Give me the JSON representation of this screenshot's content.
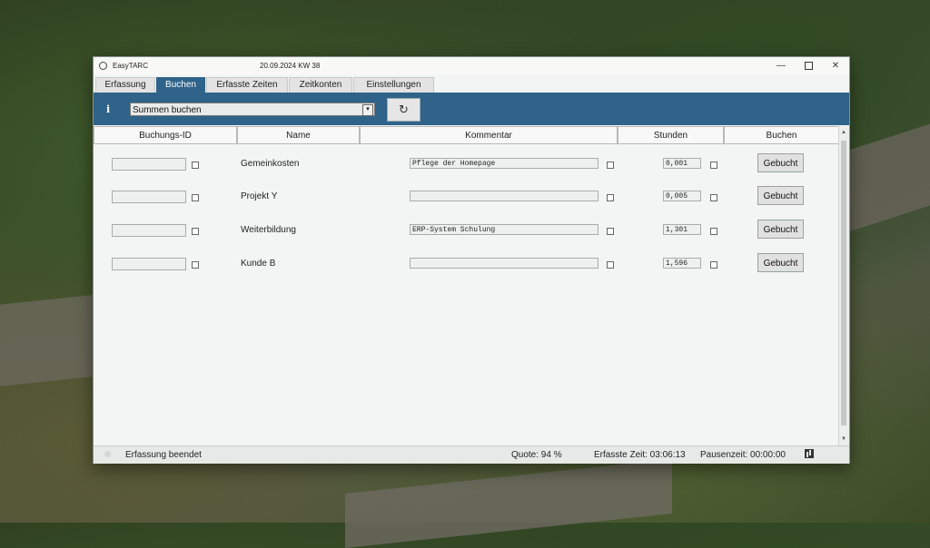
{
  "window": {
    "app_title": "EasyTARC",
    "date_week": "20.09.2024  KW 38",
    "controls": {
      "minimize": "—",
      "close": "✕"
    }
  },
  "tabs": [
    {
      "label": "Erfassung",
      "active": false
    },
    {
      "label": "Buchen",
      "active": true
    },
    {
      "label": "Erfasste Zeiten",
      "active": false
    },
    {
      "label": "Zeitkonten",
      "active": false
    },
    {
      "label": "Einstellungen",
      "active": false
    }
  ],
  "toolbar": {
    "info_icon": "i",
    "select_value": "Summen buchen",
    "select_arrow": "▾",
    "refresh_icon": "↻"
  },
  "grid": {
    "headers": [
      "Buchungs-ID",
      "Name",
      "Kommentar",
      "Stunden",
      "Buchen"
    ],
    "rows": [
      {
        "id": "",
        "name": "Gemeinkosten",
        "comment": "Pflege der Homepage",
        "hours": "0,001",
        "button": "Gebucht"
      },
      {
        "id": "",
        "name": "Projekt Y",
        "comment": "",
        "hours": "0,005",
        "button": "Gebucht"
      },
      {
        "id": "",
        "name": "Weiterbildung",
        "comment": "ERP-System Schulung",
        "hours": "1,301",
        "button": "Gebucht"
      },
      {
        "id": "",
        "name": "Kunde B",
        "comment": "",
        "hours": "1,596",
        "button": "Gebucht"
      }
    ],
    "scroll_up": "▲",
    "scroll_down": "▼"
  },
  "status": {
    "text": "Erfassung beendet",
    "quote": "Quote:  94 %",
    "erfasst": "Erfasste Zeit:  03:06:13",
    "pause": "Pausenzeit:  00:00:00"
  },
  "colors": {
    "accent": "#2f6389",
    "window_bg": "#f3f5f4"
  }
}
